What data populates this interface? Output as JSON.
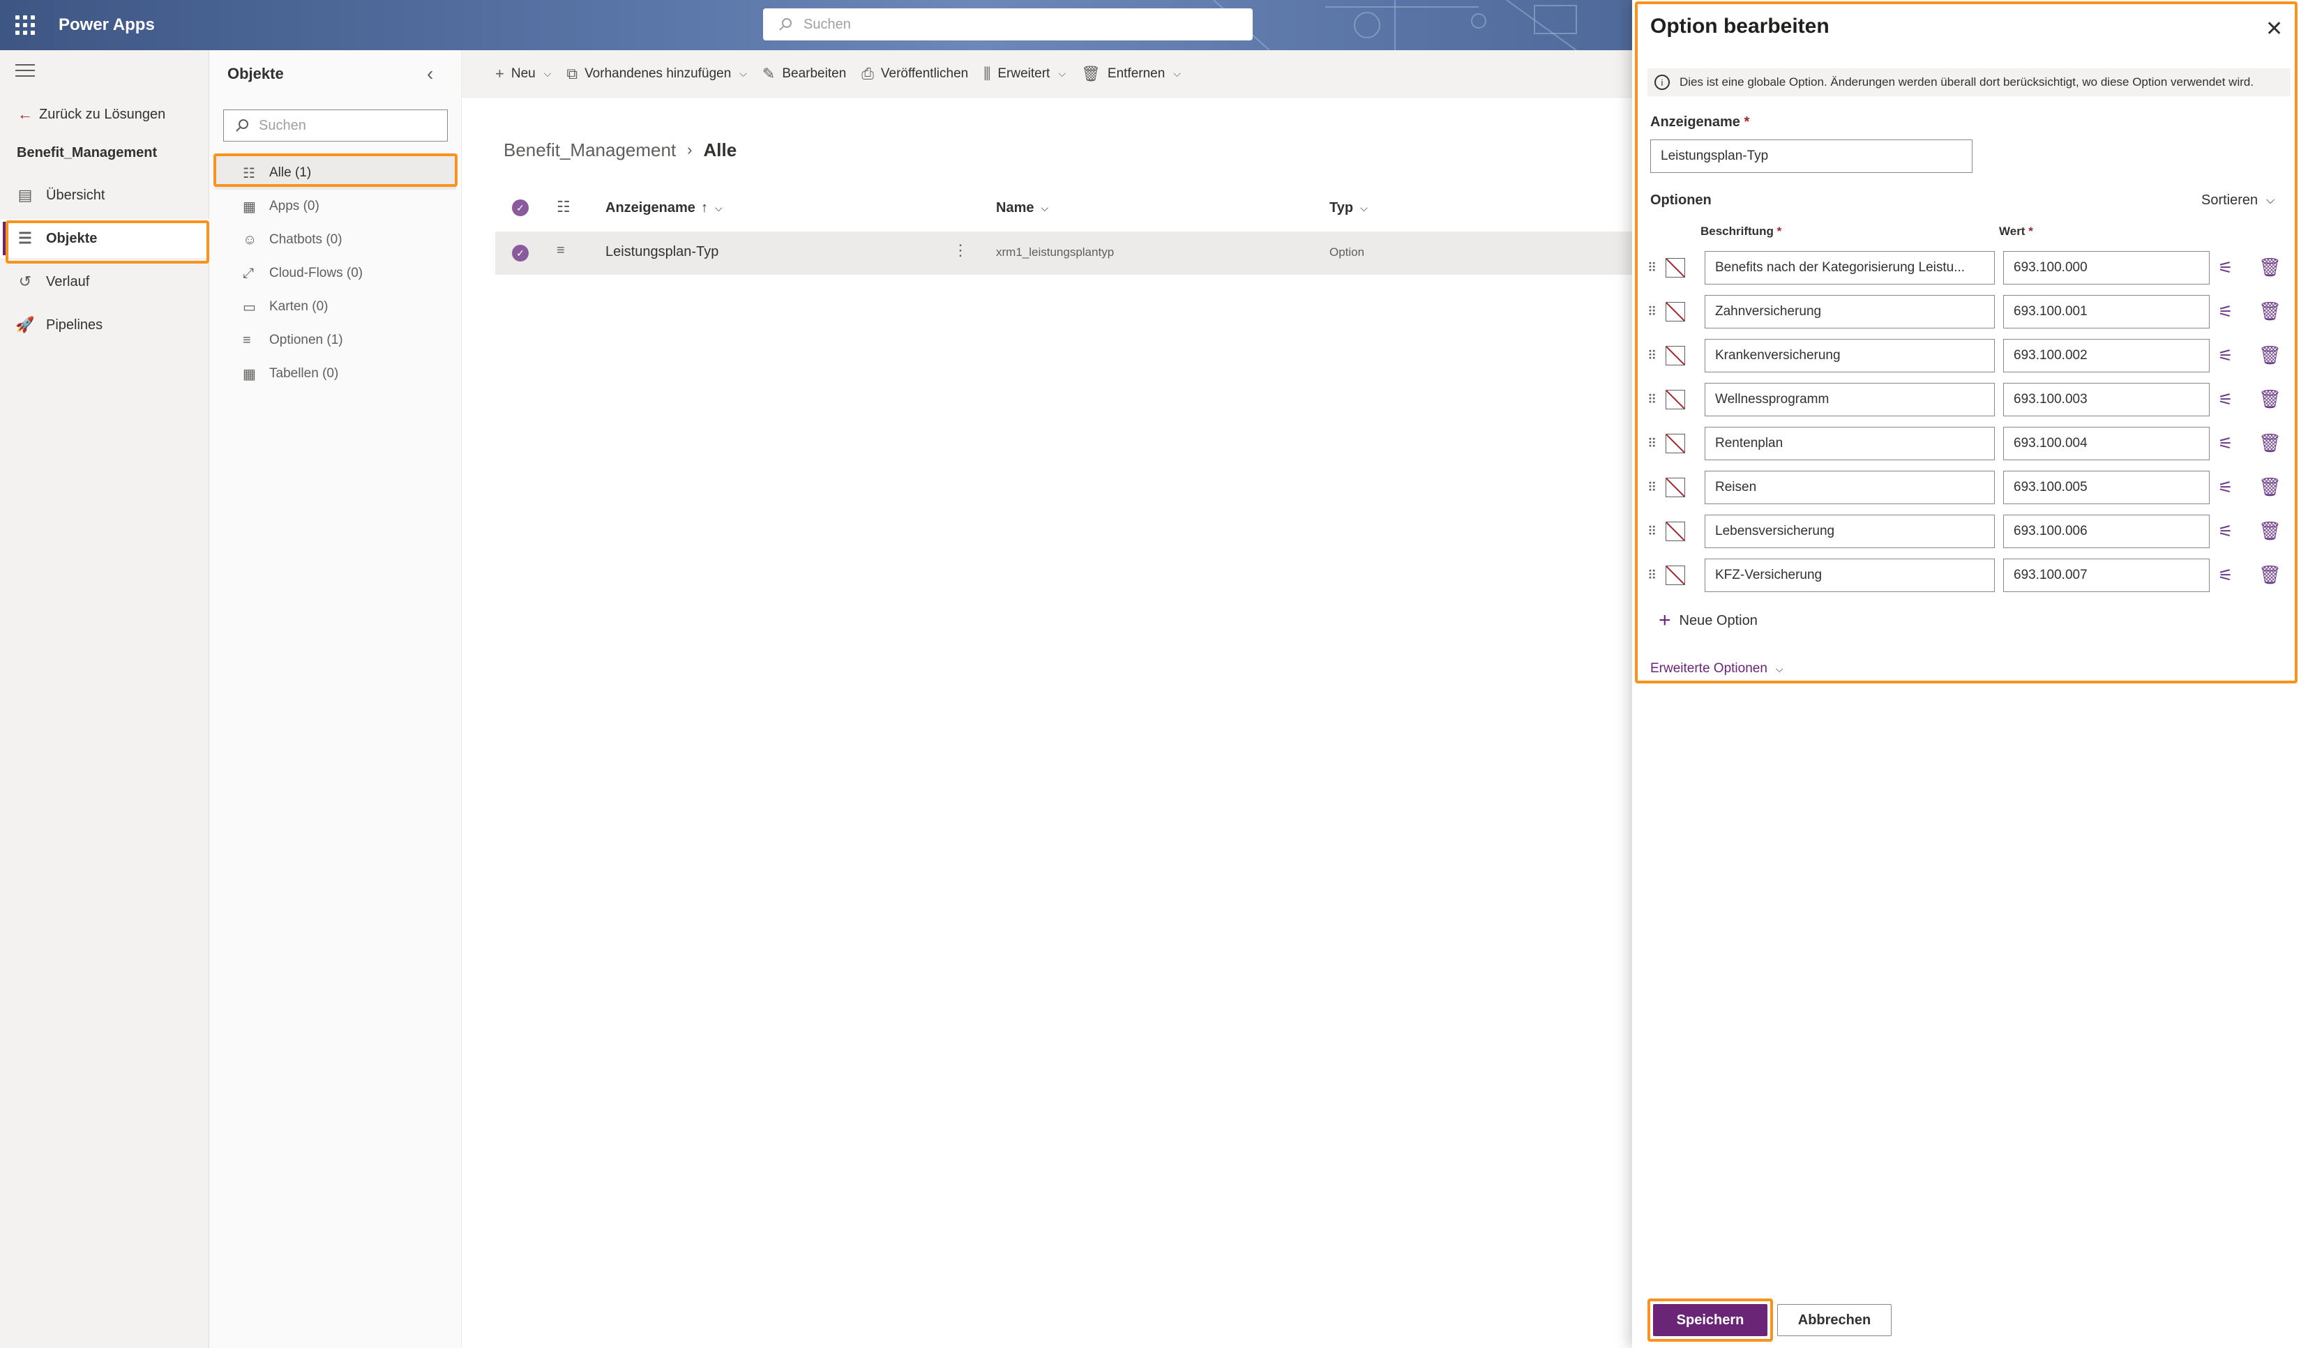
{
  "app": {
    "title": "Power Apps",
    "search_placeholder": "Suchen"
  },
  "leftnav": {
    "back": "Zurück zu Lösungen",
    "solution": "Benefit_Management",
    "items": [
      {
        "label": "Übersicht",
        "icon": "overview-icon"
      },
      {
        "label": "Objekte",
        "icon": "objects-icon",
        "selected": true
      },
      {
        "label": "Verlauf",
        "icon": "history-icon"
      },
      {
        "label": "Pipelines",
        "icon": "pipelines-icon"
      }
    ]
  },
  "objects": {
    "title": "Objekte",
    "search_placeholder": "Suchen",
    "items": [
      {
        "label": "Alle",
        "count": "(1)",
        "selected": true
      },
      {
        "label": "Apps",
        "count": "(0)"
      },
      {
        "label": "Chatbots",
        "count": "(0)"
      },
      {
        "label": "Cloud-Flows",
        "count": "(0)"
      },
      {
        "label": "Karten",
        "count": "(0)"
      },
      {
        "label": "Optionen",
        "count": "(1)"
      },
      {
        "label": "Tabellen",
        "count": "(0)"
      }
    ]
  },
  "commands": {
    "new": "Neu",
    "add_existing": "Vorhandenes hinzufügen",
    "edit": "Bearbeiten",
    "publish": "Veröffentlichen",
    "advanced": "Erweitert",
    "remove": "Entfernen"
  },
  "content": {
    "breadcrumb_root": "Benefit_Management",
    "breadcrumb_current": "Alle",
    "columns": {
      "display_name": "Anzeigename",
      "sort_indicator": "↑",
      "name": "Name",
      "type": "Typ"
    },
    "rows": [
      {
        "display_name": "Leistungsplan-Typ",
        "name": "xrm1_leistungsplantyp",
        "type": "Option"
      }
    ]
  },
  "panel": {
    "title": "Option bearbeiten",
    "info": "Dies ist eine globale Option. Änderungen werden überall dort berücksichtigt, wo diese Option verwendet wird.",
    "display_name_label": "Anzeigename",
    "display_name_value": "Leistungsplan-Typ",
    "options_label": "Optionen",
    "sort_label": "Sortieren",
    "col_label": "Beschriftung",
    "col_value": "Wert",
    "required_mark": "*",
    "options": [
      {
        "label": "Benefits nach der Kategorisierung Leistu...",
        "value": "693.100.000"
      },
      {
        "label": "Zahnversicherung",
        "value": "693.100.001"
      },
      {
        "label": "Krankenversicherung",
        "value": "693.100.002"
      },
      {
        "label": "Wellnessprogramm",
        "value": "693.100.003"
      },
      {
        "label": "Rentenplan",
        "value": "693.100.004"
      },
      {
        "label": "Reisen",
        "value": "693.100.005"
      },
      {
        "label": "Lebensversicherung",
        "value": "693.100.006"
      },
      {
        "label": "KFZ-Versicherung",
        "value": "693.100.007"
      }
    ],
    "new_option": "Neue Option",
    "advanced_options": "Erweiterte Optionen",
    "save": "Speichern",
    "cancel": "Abbrechen"
  },
  "colors": {
    "accent": "#6b2577",
    "highlight": "#f7931e",
    "topbar": "#4a6494"
  }
}
